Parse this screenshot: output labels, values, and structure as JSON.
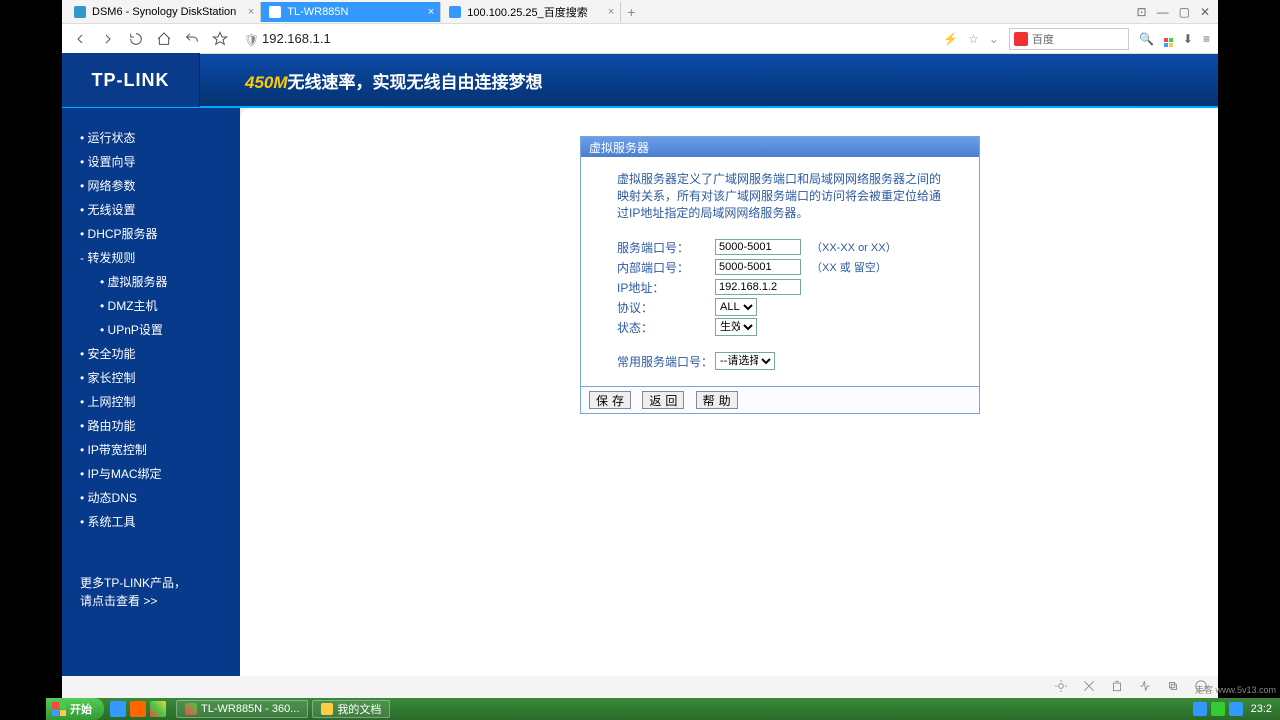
{
  "browser": {
    "tabs": [
      {
        "title": "DSM6 - Synology DiskStation"
      },
      {
        "title": "TL-WR885N"
      },
      {
        "title": "100.100.25.25_百度搜索"
      }
    ],
    "url": "192.168.1.1",
    "search_placeholder": "百度"
  },
  "header": {
    "logo": "TP-LINK",
    "slogan_prefix": "450M",
    "slogan_rest": "无线速率，实现无线自由连接梦想"
  },
  "sidebar": {
    "items": [
      {
        "label": "• 运行状态",
        "sub": false
      },
      {
        "label": "• 设置向导",
        "sub": false
      },
      {
        "label": "• 网络参数",
        "sub": false
      },
      {
        "label": "• 无线设置",
        "sub": false
      },
      {
        "label": "• DHCP服务器",
        "sub": false
      },
      {
        "label": "- 转发规则",
        "sub": false
      },
      {
        "label": "• 虚拟服务器",
        "sub": true
      },
      {
        "label": "• DMZ主机",
        "sub": true
      },
      {
        "label": "• UPnP设置",
        "sub": true
      },
      {
        "label": "• 安全功能",
        "sub": false
      },
      {
        "label": "• 家长控制",
        "sub": false
      },
      {
        "label": "• 上网控制",
        "sub": false
      },
      {
        "label": "• 路由功能",
        "sub": false
      },
      {
        "label": "• IP带宽控制",
        "sub": false
      },
      {
        "label": "• IP与MAC绑定",
        "sub": false
      },
      {
        "label": "• 动态DNS",
        "sub": false
      },
      {
        "label": "• 系统工具",
        "sub": false
      }
    ],
    "more1": "更多TP-LINK产品，",
    "more2": "请点击查看 >>"
  },
  "panel": {
    "title": "虚拟服务器",
    "desc": "虚拟服务器定义了广域网服务端口和局域网网络服务器之间的映射关系，所有对该广域网服务端口的访问将会被重定位给通过IP地址指定的局域网网络服务器。",
    "labels": {
      "service_port": "服务端口号：",
      "internal_port": "内部端口号：",
      "ip": "IP地址：",
      "protocol": "协议：",
      "status": "状态：",
      "common": "常用服务端口号："
    },
    "values": {
      "service_port": "5000-5001",
      "internal_port": "5000-5001",
      "ip": "192.168.1.2",
      "protocol": "ALL",
      "status": "生效",
      "common": "--请选择--"
    },
    "hints": {
      "service_port": "（XX-XX or XX）",
      "internal_port": "（XX 或 留空）"
    },
    "buttons": {
      "save": "保存",
      "back": "返回",
      "help": "帮助"
    }
  },
  "taskbar": {
    "start": "开始",
    "tasks": [
      "TL-WR885N - 360...",
      "我的文档"
    ],
    "clock": "23:2"
  },
  "watermark": "走客 www.5v13.com"
}
